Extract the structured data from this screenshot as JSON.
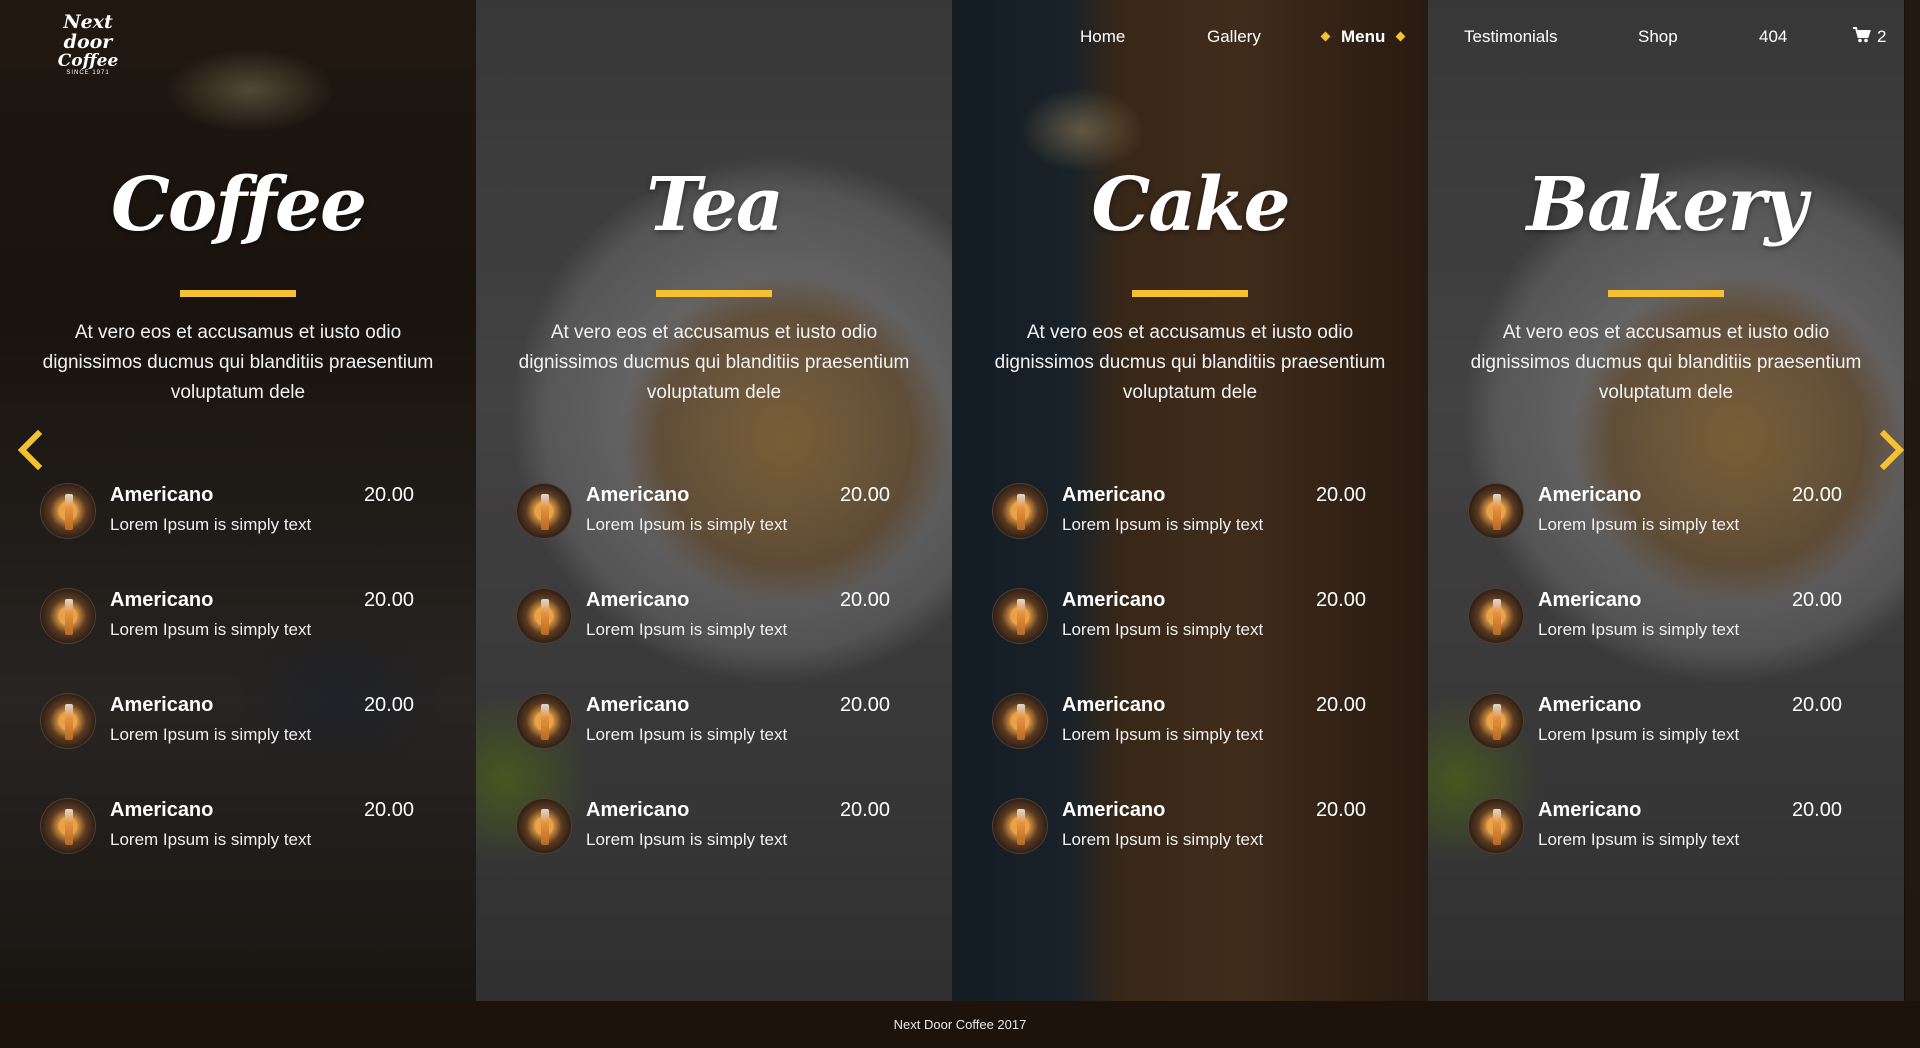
{
  "logo": {
    "line1": "Next door",
    "line2": "Coffee",
    "line3": "SINCE 1971"
  },
  "nav": {
    "items": [
      {
        "label": "Home"
      },
      {
        "label": "Gallery"
      },
      {
        "label": "Menu"
      },
      {
        "label": "Testimonials"
      },
      {
        "label": "Shop"
      },
      {
        "label": "404"
      }
    ],
    "cart_count": "2",
    "accent": "#f5c130"
  },
  "panels": [
    {
      "title": "Coffee",
      "description": "At vero eos et accusamus et iusto odio dignissimos ducmus qui blanditiis praesentium voluptatum dele",
      "items": [
        {
          "name": "Americano",
          "price": "20.00",
          "desc": "Lorem Ipsum is simply text"
        },
        {
          "name": "Americano",
          "price": "20.00",
          "desc": "Lorem Ipsum is simply text"
        },
        {
          "name": "Americano",
          "price": "20.00",
          "desc": "Lorem Ipsum is simply text"
        },
        {
          "name": "Americano",
          "price": "20.00",
          "desc": "Lorem Ipsum is simply text"
        }
      ]
    },
    {
      "title": "Tea",
      "description": "At vero eos et accusamus et iusto odio dignissimos ducmus qui blanditiis praesentium voluptatum dele",
      "items": [
        {
          "name": "Americano",
          "price": "20.00",
          "desc": "Lorem Ipsum is simply text"
        },
        {
          "name": "Americano",
          "price": "20.00",
          "desc": "Lorem Ipsum is simply text"
        },
        {
          "name": "Americano",
          "price": "20.00",
          "desc": "Lorem Ipsum is simply text"
        },
        {
          "name": "Americano",
          "price": "20.00",
          "desc": "Lorem Ipsum is simply text"
        }
      ]
    },
    {
      "title": "Cake",
      "description": "At vero eos et accusamus et iusto odio dignissimos ducmus qui blanditiis praesentium voluptatum dele",
      "items": [
        {
          "name": "Americano",
          "price": "20.00",
          "desc": "Lorem Ipsum is simply text"
        },
        {
          "name": "Americano",
          "price": "20.00",
          "desc": "Lorem Ipsum is simply text"
        },
        {
          "name": "Americano",
          "price": "20.00",
          "desc": "Lorem Ipsum is simply text"
        },
        {
          "name": "Americano",
          "price": "20.00",
          "desc": "Lorem Ipsum is simply text"
        }
      ]
    },
    {
      "title": "Bakery",
      "description": "At vero eos et accusamus et iusto odio dignissimos ducmus qui blanditiis praesentium voluptatum dele",
      "items": [
        {
          "name": "Americano",
          "price": "20.00",
          "desc": "Lorem Ipsum is simply text"
        },
        {
          "name": "Americano",
          "price": "20.00",
          "desc": "Lorem Ipsum is simply text"
        },
        {
          "name": "Americano",
          "price": "20.00",
          "desc": "Lorem Ipsum is simply text"
        },
        {
          "name": "Americano",
          "price": "20.00",
          "desc": "Lorem Ipsum is simply text"
        }
      ]
    }
  ],
  "carousel": {
    "prev_icon": "chevron-left-icon",
    "next_icon": "chevron-right-icon",
    "arrow_color": "#f5c130"
  },
  "footer": {
    "text": "Next Door Coffee 2017"
  }
}
